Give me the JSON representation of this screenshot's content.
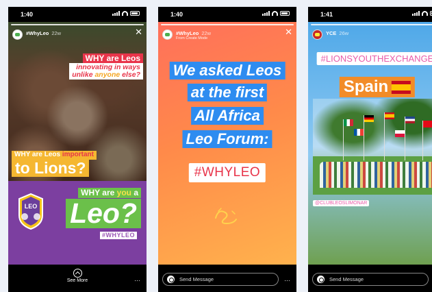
{
  "stories": [
    {
      "time": "1:40",
      "account": "#WhyLeo",
      "age": "22w",
      "texts": {
        "line1": "WHY are Leos",
        "line2a": "innovating in ways",
        "line2b": "unlike ",
        "line2c": "anyone",
        "line2d": " else?",
        "line3a": "WHY are Leos ",
        "line3b": "important",
        "line4": "to Lions?",
        "line5a": "WHY are ",
        "line5b": "you",
        "line5c": " a",
        "line6": "Leo?",
        "hashtag": "#WHYLEO"
      },
      "logo_text": "LEO",
      "bottom": {
        "see_more": "See More",
        "more": "…"
      }
    },
    {
      "time": "1:40",
      "account": "#WhyLeo",
      "age": "22w",
      "subtitle": "From Create Mode",
      "lines": [
        "We asked Leos",
        "at the first",
        "All Africa",
        "Leo Forum:"
      ],
      "hashtag": "#WHYLEO",
      "bottom": {
        "send_placeholder": "Send Message",
        "more": "…"
      }
    },
    {
      "time": "1:41",
      "account": "YCE",
      "age": "26w",
      "hashtag": "#LIONSYOUTHEXCHANGE",
      "country": "Spain",
      "mention": "@CLUBLEOSLIMONAR",
      "bottom": {
        "send_placeholder": "Send Message",
        "more": "…"
      }
    }
  ],
  "colors": {
    "red": "#e8344a",
    "gold": "#f5b731",
    "green": "#6bc04a",
    "purple": "#7c3fa0",
    "blue": "#2e8cf0",
    "orange": "#f28c28"
  }
}
